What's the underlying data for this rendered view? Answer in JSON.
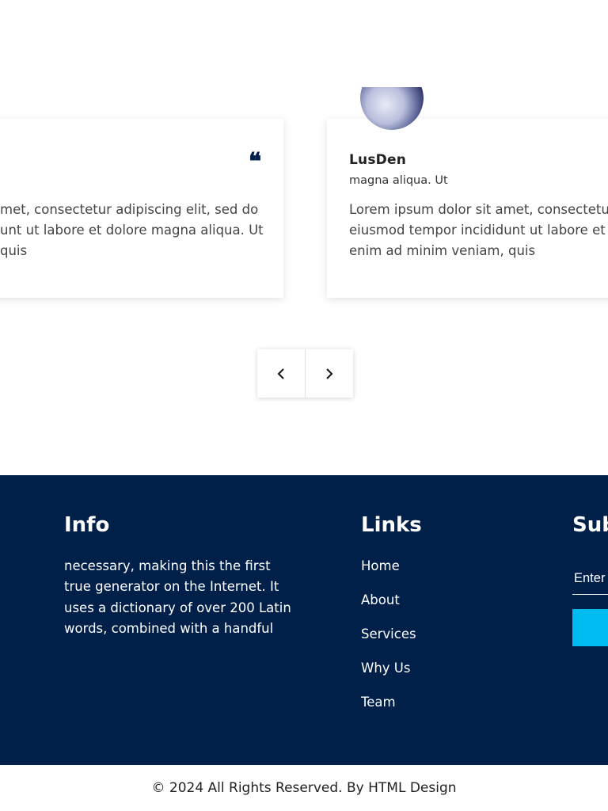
{
  "testimonials": {
    "cards": [
      {
        "lines": [
          "met, consectetur adipiscing elit, sed do",
          "unt ut labore et dolore magna aliqua. Ut",
          "quis"
        ]
      },
      {
        "name": "LusDen",
        "subtitle": "magna aliqua. Ut",
        "lines": [
          "Lorem ipsum dolor sit amet, consectetur",
          "eiusmod tempor incididunt ut labore et d",
          "enim ad minim veniam, quis"
        ]
      }
    ],
    "controls": {
      "prev_icon": "chevron-left-icon",
      "next_icon": "chevron-right-icon"
    }
  },
  "footer": {
    "info": {
      "heading": "Info",
      "lines": [
        "necessary, making this the first",
        "true generator on the Internet. It",
        "uses a dictionary of over 200 Latin",
        "words, combined with a handful"
      ]
    },
    "links": {
      "heading": "Links",
      "items": [
        "Home",
        "About",
        "Services",
        "Why Us",
        "Team"
      ]
    },
    "subscribe": {
      "heading": "Sub",
      "placeholder": "Enter",
      "button_label": ""
    },
    "colors": {
      "background": "#00204a",
      "accent": "#00bbf0"
    }
  },
  "copyright": "© 2024 All Rights Reserved. By HTML Design"
}
